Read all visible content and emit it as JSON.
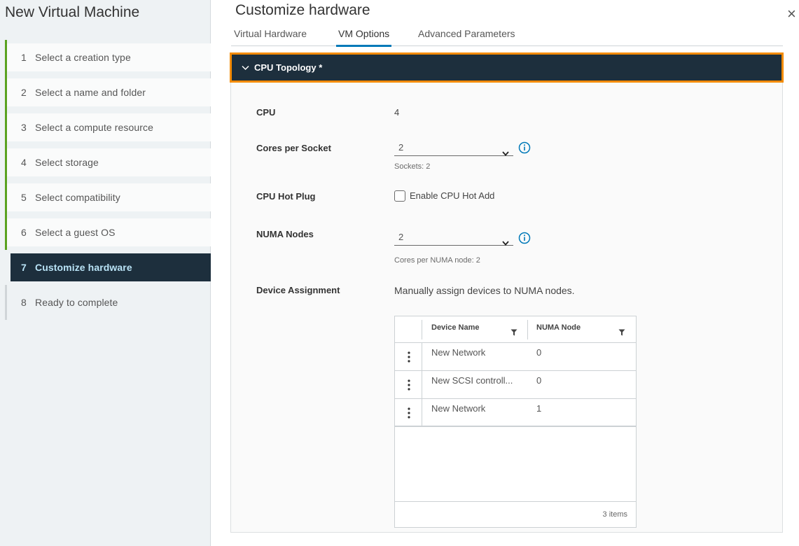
{
  "sidebar": {
    "title": "New Virtual Machine",
    "steps": [
      {
        "num": "1",
        "label": "Select a creation type"
      },
      {
        "num": "2",
        "label": "Select a name and folder"
      },
      {
        "num": "3",
        "label": "Select a compute resource"
      },
      {
        "num": "4",
        "label": "Select storage"
      },
      {
        "num": "5",
        "label": "Select compatibility"
      },
      {
        "num": "6",
        "label": "Select a guest OS"
      },
      {
        "num": "7",
        "label": "Customize hardware"
      },
      {
        "num": "8",
        "label": "Ready to complete"
      }
    ]
  },
  "header": {
    "title": "Customize hardware",
    "close_glyph": "×",
    "tabs": [
      {
        "label": "Virtual Hardware"
      },
      {
        "label": "VM Options"
      },
      {
        "label": "Advanced Parameters"
      }
    ]
  },
  "section": {
    "title": "CPU Topology *",
    "cpu_label": "CPU",
    "cpu_value": "4",
    "cores_label": "Cores per Socket",
    "cores_value": "2",
    "sockets_hint": "Sockets: 2",
    "hotplug_label": "CPU Hot Plug",
    "hotplug_option": "Enable CPU Hot Add",
    "numa_label": "NUMA Nodes",
    "numa_value": "2",
    "numa_hint": "Cores per NUMA node: 2",
    "device_label": "Device Assignment",
    "device_desc": "Manually assign devices to NUMA nodes."
  },
  "grid": {
    "columns": [
      "Device Name",
      "NUMA Node"
    ],
    "rows": [
      {
        "name": "New Network",
        "node": "0"
      },
      {
        "name": "New SCSI controll...",
        "node": "0"
      },
      {
        "name": "New Network",
        "node": "1"
      }
    ],
    "count": "3 items"
  },
  "colors": {
    "accent_blue": "#0079b8",
    "header_dark": "#1d2f3d",
    "highlight_orange": "#f38b00",
    "progress_green": "#5aa220"
  }
}
